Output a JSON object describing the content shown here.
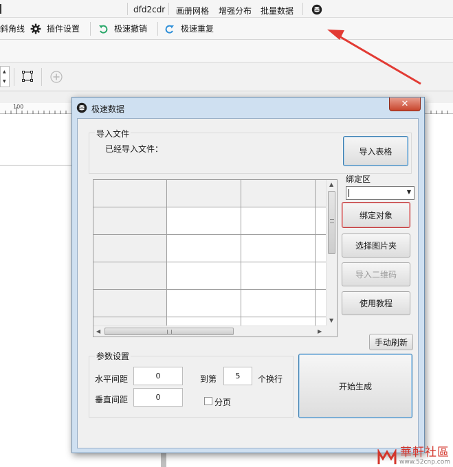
{
  "app": {
    "topbar": {
      "tabs": [
        "dfd2cdr",
        "画册网格",
        "增强分布",
        "批量数据"
      ]
    },
    "menu": {
      "items": [
        {
          "label": "斜角线",
          "icon": "none"
        },
        {
          "label": "插件设置",
          "icon": "gear-icon"
        },
        {
          "label": "极速撤销",
          "icon": "undo-icon"
        },
        {
          "label": "极速重复",
          "icon": "redo-icon"
        }
      ]
    },
    "ruler": {
      "tick_label": "100"
    }
  },
  "dialog": {
    "title": "极速数据",
    "close_label": "✕",
    "import_group": {
      "title": "导入文件",
      "status_label": "已经导入文件：",
      "import_button": "导入表格"
    },
    "bind_area": {
      "label": "绑定区",
      "combo_value": "",
      "bind_button": "绑定对象",
      "select_folder_button": "选择图片夹",
      "import_qr_button": "导入二维码",
      "tutorial_button": "使用教程"
    },
    "refresh_button": "手动刷新",
    "params_group": {
      "title": "参数设置",
      "h_spacing_label": "水平间距",
      "h_spacing_value": "0",
      "v_spacing_label": "垂直间距",
      "v_spacing_value": "0",
      "wrap_prefix": "到第",
      "wrap_value": "5",
      "wrap_suffix": "个换行",
      "paging_label": "分页",
      "paging_checked": false
    },
    "generate_button": "开始生成"
  },
  "watermark": {
    "brand": "華軒社區",
    "url": "www.52cnp.com"
  },
  "colors": {
    "dialog_frame": "#cfe0f1",
    "focus_blue": "#3c7fb1",
    "focus_red": "#c0393b",
    "arrow_red": "#e23b34"
  }
}
